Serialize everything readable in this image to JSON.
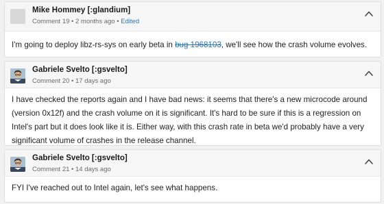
{
  "comments": [
    {
      "author": "Mike Hommey [:glandium]",
      "comment_num": "Comment 19",
      "time": "2 months ago",
      "edited": "Edited",
      "body_before": "I'm going to deploy libz-rs-sys on early beta in ",
      "bug_link": "bug 1968103",
      "body_after": ", we'll see how the crash volume evolves."
    },
    {
      "author": "Gabriele Svelto [:gsvelto]",
      "comment_num": "Comment 20",
      "time": "17 days ago",
      "body": "I have checked the reports again and I have bad news: it seems that there's a new microcode around (version 0x12f) and the crash volume on it is significant. It's hard to be sure if this is a regression on Intel's part but it does look like it is. Either way, with this crash rate in beta we'd probably have a very significant volume of crashes in the release channel."
    },
    {
      "author": "Gabriele Svelto [:gsvelto]",
      "comment_num": "Comment 21",
      "time": "14 days ago",
      "body": "FYI I've reached out to Intel again, let's see what happens."
    }
  ],
  "separator": "•",
  "colors": {
    "link": "#2a74b8",
    "header_bg": "#f6f6f6",
    "page_bg": "#f1f1f1"
  },
  "icons": {
    "collapse": "chevron-up-icon",
    "avatar_default": "default-avatar-icon",
    "avatar_user": "user-photo-avatar"
  }
}
